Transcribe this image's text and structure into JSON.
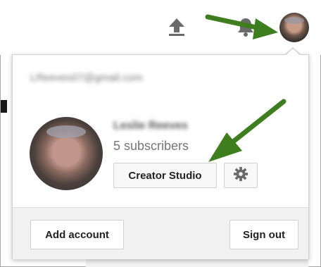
{
  "header": {
    "icons": [
      "upload-icon",
      "bell-icon"
    ],
    "avatar": "account-avatar"
  },
  "account_menu": {
    "email": "LReeves07@gmail.com",
    "user_name": "Leslie Reeves",
    "subscribers": "5 subscribers",
    "creator_studio_label": "Creator Studio",
    "settings_icon": "gear-icon",
    "add_account_label": "Add account",
    "sign_out_label": "Sign out"
  },
  "annotation": {
    "arrow_color": "#3f7e1f"
  }
}
